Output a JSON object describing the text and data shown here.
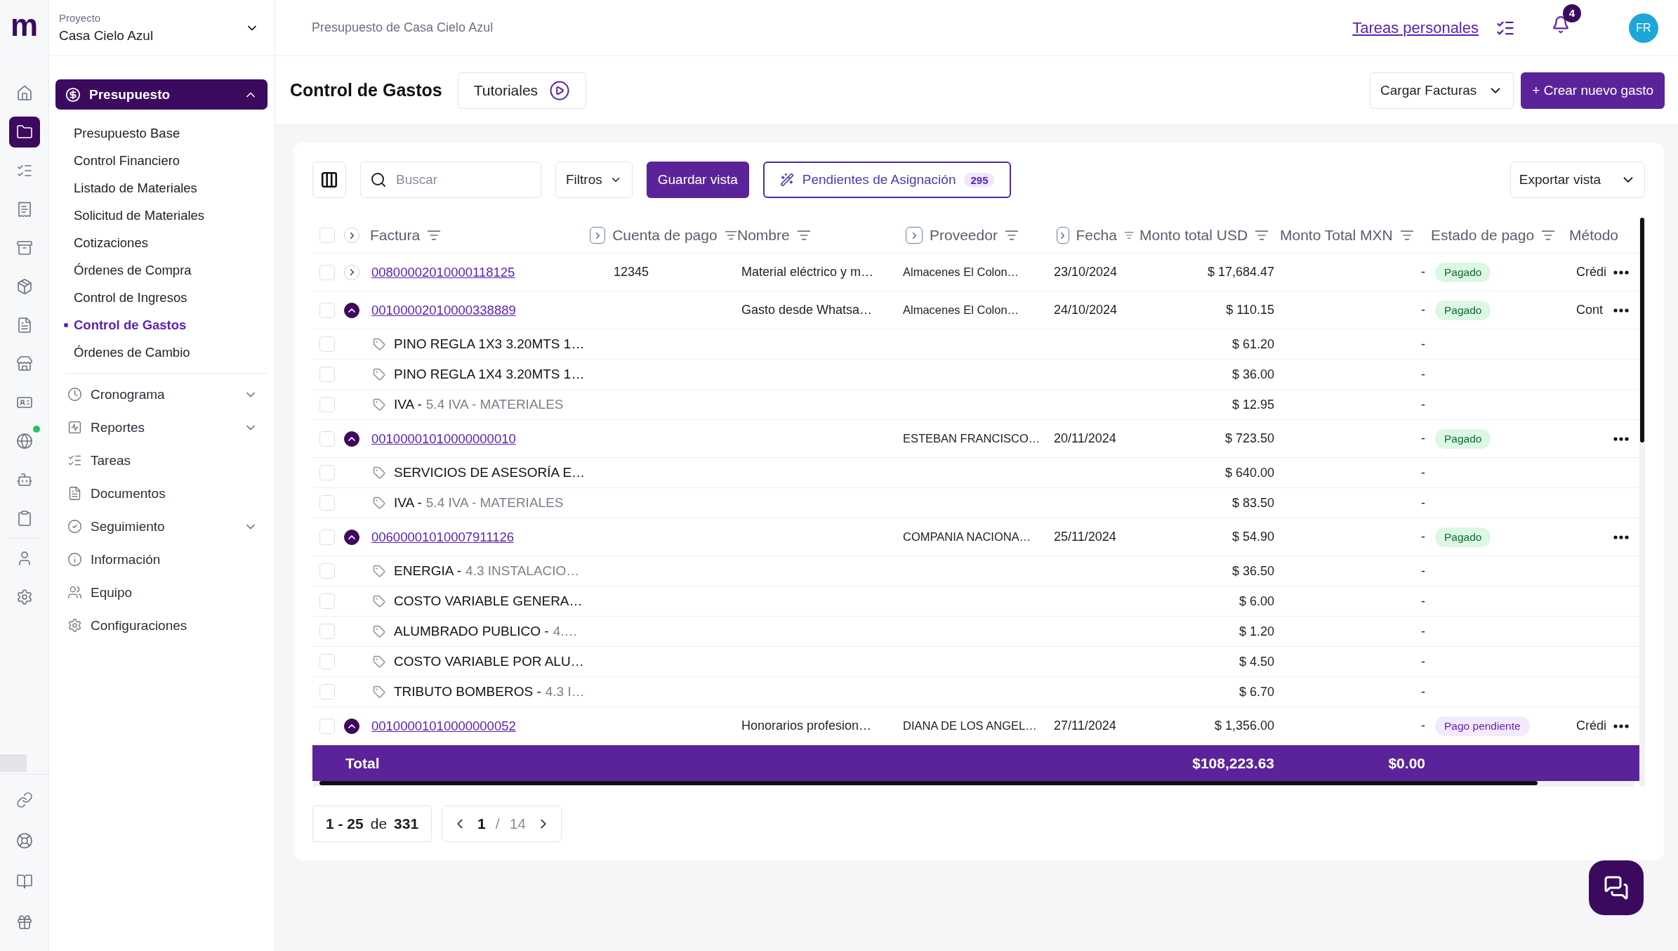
{
  "logo": "m",
  "rail": {
    "top": [
      {
        "selected": false,
        "badge": false
      },
      {
        "selected": true,
        "badge": false
      },
      {
        "selected": false,
        "badge": false
      },
      {
        "selected": false,
        "badge": false
      },
      {
        "selected": false,
        "badge": false
      },
      {
        "selected": false,
        "badge": false
      },
      {
        "selected": false,
        "badge": false
      },
      {
        "selected": false,
        "badge": false
      },
      {
        "selected": false,
        "badge": false
      },
      {
        "selected": false,
        "badge": true
      },
      {
        "selected": false,
        "badge": false
      },
      {
        "selected": false,
        "badge": false
      }
    ],
    "middle": [
      {
        "selected": false,
        "badge": false
      },
      {
        "selected": false,
        "badge": false
      }
    ],
    "bottom": [
      {
        "selected": false,
        "badge": false
      },
      {
        "selected": false,
        "badge": false
      },
      {
        "selected": false,
        "badge": false
      },
      {
        "selected": false,
        "badge": false
      }
    ]
  },
  "project": {
    "label": "Proyecto",
    "name": "Casa Cielo Azul"
  },
  "nav": {
    "section": {
      "label": "Presupuesto",
      "expanded": true
    },
    "subitems": [
      {
        "label": "Presupuesto Base",
        "selected": false
      },
      {
        "label": "Control Financiero",
        "selected": false
      },
      {
        "label": "Listado de Materiales",
        "selected": false
      },
      {
        "label": "Solicitud de Materiales",
        "selected": false
      },
      {
        "label": "Cotizaciones",
        "selected": false
      },
      {
        "label": "Órdenes de Compra",
        "selected": false
      },
      {
        "label": "Control de Ingresos",
        "selected": false
      },
      {
        "label": "Control de Gastos",
        "selected": true
      },
      {
        "label": "Órdenes de Cambio",
        "selected": false
      }
    ],
    "items": [
      {
        "label": "Cronograma",
        "kind": "group"
      },
      {
        "label": "Reportes",
        "kind": "group"
      },
      {
        "label": "Tareas",
        "kind": "link"
      },
      {
        "label": "Documentos",
        "kind": "link"
      },
      {
        "label": "Seguimiento",
        "kind": "group"
      },
      {
        "label": "Información",
        "kind": "link"
      },
      {
        "label": "Equipo",
        "kind": "link"
      },
      {
        "label": "Configuraciones",
        "kind": "link"
      }
    ]
  },
  "breadcrumb": "Presupuesto de Casa Cielo Azul",
  "header_actions": {
    "tasks_link": "Tareas personales",
    "notifications": "4",
    "avatar": "FR"
  },
  "page": {
    "title": "Control de Gastos",
    "tutorials": "Tutoriales",
    "upload": "Cargar Facturas",
    "create": "+ Crear nuevo gasto"
  },
  "toolbar": {
    "search": {
      "placeholder": "Buscar"
    },
    "filters": "Filtros",
    "save_view": "Guardar vista",
    "pending": {
      "label": "Pendientes de Asignación",
      "count": "295"
    },
    "export": "Exportar vista"
  },
  "table": {
    "header_checked": false,
    "columns": [
      {
        "label": "Factura",
        "filter": true,
        "pin": false
      },
      {
        "label": "Cuenta de pago",
        "filter": true,
        "pin": true
      },
      {
        "label": "Nombre",
        "filter": true,
        "pin": false
      },
      {
        "label": "Proveedor",
        "filter": true,
        "pin": true
      },
      {
        "label": "Fecha",
        "filter": true,
        "pin": true
      },
      {
        "label": "Monto total USD",
        "filter": true,
        "pin": false
      },
      {
        "label": "Monto Total MXN",
        "filter": true,
        "pin": false
      },
      {
        "label": "Estado de pago",
        "filter": true,
        "pin": false
      },
      {
        "label": "Método",
        "filter": false,
        "pin": false
      }
    ],
    "rows": [
      {
        "kind": "invoice",
        "checked": false,
        "expanded": false,
        "invoice": "00800002010000118125",
        "account": "12345",
        "name": "Material eléctrico y m…",
        "supplier": "Almacenes El Colon…",
        "date": "23/10/2024",
        "usd": "$ 17,684.47",
        "mxn": "-",
        "status": {
          "label": "Pagado",
          "kind": "paid"
        },
        "method": "Crédi"
      },
      {
        "kind": "invoice",
        "checked": false,
        "expanded": true,
        "invoice": "00100002010000338889",
        "name": "Gasto desde Whatsa…",
        "supplier": "Almacenes El Colon…",
        "date": "24/10/2024",
        "usd": "$ 110.15",
        "mxn": "-",
        "status": {
          "label": "Pagado",
          "kind": "paid"
        },
        "method": "Cont"
      },
      {
        "kind": "line",
        "checked": false,
        "label": "PINO REGLA 1X3 3.20MTS 1…",
        "usd": "$ 61.20",
        "mxn": "-"
      },
      {
        "kind": "line",
        "checked": false,
        "label": "PINO REGLA 1X4 3.20MTS 1…",
        "usd": "$ 36.00",
        "mxn": "-"
      },
      {
        "kind": "line",
        "checked": false,
        "label": "IVA -",
        "detail": "5.4 IVA - MATERIALES",
        "usd": "$ 12.95",
        "mxn": "-"
      },
      {
        "kind": "invoice",
        "checked": false,
        "expanded": true,
        "invoice": "00100001010000000010",
        "supplier": "ESTEBAN FRANCISCO…",
        "date": "20/11/2024",
        "usd": "$ 723.50",
        "mxn": "-",
        "status": {
          "label": "Pagado",
          "kind": "paid"
        }
      },
      {
        "kind": "line",
        "checked": false,
        "label": "SERVICIOS DE ASESORÍA E…",
        "usd": "$ 640.00",
        "mxn": "-"
      },
      {
        "kind": "line",
        "checked": false,
        "label": "IVA -",
        "detail": "5.4 IVA - MATERIALES",
        "usd": "$ 83.50",
        "mxn": "-"
      },
      {
        "kind": "invoice",
        "checked": false,
        "expanded": true,
        "invoice": "00600001010007911126",
        "supplier": "COMPANIA NACIONA…",
        "date": "25/11/2024",
        "usd": "$ 54.90",
        "mxn": "-",
        "status": {
          "label": "Pagado",
          "kind": "paid"
        }
      },
      {
        "kind": "line",
        "checked": false,
        "label": "ENERGIA -",
        "detail": "4.3 INSTALACIO…",
        "usd": "$ 36.50",
        "mxn": "-"
      },
      {
        "kind": "line",
        "checked": false,
        "label": "COSTO VARIABLE GENERA…",
        "usd": "$ 6.00",
        "mxn": "-"
      },
      {
        "kind": "line",
        "checked": false,
        "label": "ALUMBRADO PUBLICO -",
        "detail": "4.…",
        "usd": "$ 1.20",
        "mxn": "-"
      },
      {
        "kind": "line",
        "checked": false,
        "label": "COSTO VARIABLE POR ALU…",
        "usd": "$ 4.50",
        "mxn": "-"
      },
      {
        "kind": "line",
        "checked": false,
        "label": "TRIBUTO BOMBEROS -",
        "detail": "4.3 I…",
        "usd": "$ 6.70",
        "mxn": "-"
      },
      {
        "kind": "invoice",
        "checked": false,
        "expanded": true,
        "invoice": "00100001010000000052",
        "name": "Honorarios profesion…",
        "supplier": "DIANA DE LOS ANGEL…",
        "date": "27/11/2024",
        "usd": "$ 1,356.00",
        "mxn": "-",
        "status": {
          "label": "Pago pendiente",
          "kind": "pending"
        },
        "method": "Crédi"
      }
    ],
    "total": {
      "label": "Total",
      "usd": "$108,223.63",
      "mxn": "$0.00"
    }
  },
  "pagination": {
    "range": "1 - 25",
    "of": "de",
    "total": "331",
    "page": "1",
    "separator": "/",
    "pages": "14"
  }
}
